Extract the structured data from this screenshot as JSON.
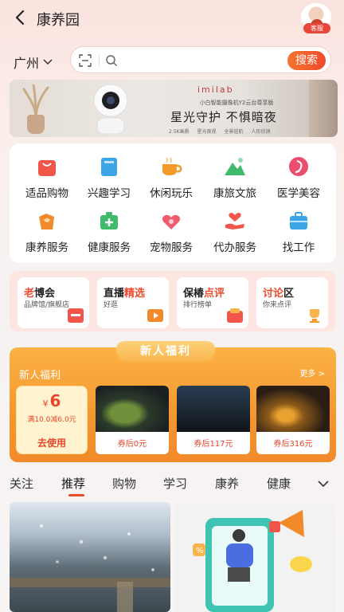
{
  "header": {
    "title": "康养园",
    "avatar_badge": "客服"
  },
  "location": {
    "city": "广州"
  },
  "search": {
    "placeholder": "",
    "button": "搜索"
  },
  "banner": {
    "brand": "imilab",
    "subtitle": "小白智能摄像机Y2云台尊享版",
    "headline": "星光守护  不惧暗夜",
    "tags": [
      "2.5K画质",
      "星光夜视",
      "全景巡航",
      "人形侦测"
    ]
  },
  "categories": [
    {
      "label": "适品购物",
      "icon": "shopping-bag-icon",
      "color": "#f2554a"
    },
    {
      "label": "兴趣学习",
      "icon": "book-icon",
      "color": "#3aa6e6"
    },
    {
      "label": "休闲玩乐",
      "icon": "tea-cup-icon",
      "color": "#f39a2b"
    },
    {
      "label": "康旅文旅",
      "icon": "mountain-icon",
      "color": "#3fbb6b"
    },
    {
      "label": "医学美容",
      "icon": "face-icon",
      "color": "#ec4d6e"
    },
    {
      "label": "康养服务",
      "icon": "hand-heart-icon",
      "color": "#f28a2a"
    },
    {
      "label": "健康服务",
      "icon": "medical-kit-icon",
      "color": "#3fbb6b"
    },
    {
      "label": "宠物服务",
      "icon": "pet-heart-icon",
      "color": "#ef5b6f"
    },
    {
      "label": "代办服务",
      "icon": "helping-hand-icon",
      "color": "#f2554a"
    },
    {
      "label": "找工作",
      "icon": "briefcase-icon",
      "color": "#3aa6e6"
    }
  ],
  "promos": [
    {
      "title_hl": "老",
      "title_rest": "博会",
      "subtitle": "品牌馆/旗舰店",
      "hl_first": true
    },
    {
      "title_rest": "直播",
      "title_hl": "精选",
      "subtitle": "好逛",
      "hl_first": false
    },
    {
      "title_rest": "保椿",
      "title_hl": "点评",
      "subtitle": "排行榜单",
      "hl_first": false
    },
    {
      "title_hl": "讨论",
      "title_rest": "区",
      "subtitle": "你来点评",
      "hl_first": true
    }
  ],
  "newbie": {
    "tab_title": "新人福利",
    "header": "新人福利",
    "more": "更多 >",
    "coupon": {
      "currency": "¥",
      "amount": "6",
      "condition": "满10.0减6.0元",
      "action": "去使用"
    },
    "products": [
      {
        "price_label": "券后0元"
      },
      {
        "price_label": "券后117元"
      },
      {
        "price_label": "券后316元"
      }
    ]
  },
  "feed_tabs": [
    "关注",
    "推荐",
    "购物",
    "学习",
    "康养",
    "健康"
  ],
  "feed_active_tab": "推荐"
}
